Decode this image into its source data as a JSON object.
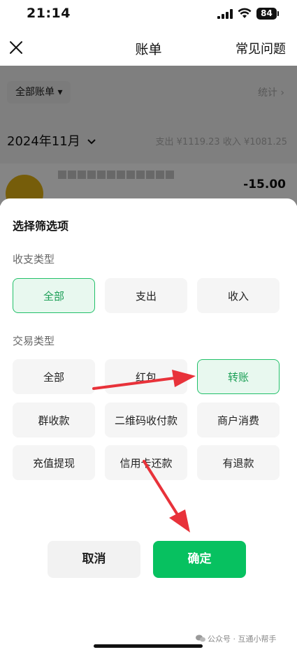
{
  "status_bar": {
    "time": "21:14",
    "battery": "84"
  },
  "nav": {
    "title": "账单",
    "faq": "常见问题"
  },
  "background": {
    "filter_label": "全部账单 ▾",
    "stats_label": "统计 ›",
    "month": "2024年11月",
    "summary": "支出 ¥1119.23   收入 ¥1081.25",
    "bill_amount": "-15.00"
  },
  "sheet": {
    "title": "选择筛选项",
    "income_type_label": "收支类型",
    "income_options": [
      {
        "label": "全部",
        "selected": true
      },
      {
        "label": "支出",
        "selected": false
      },
      {
        "label": "收入",
        "selected": false
      }
    ],
    "trade_type_label": "交易类型",
    "trade_options": [
      {
        "label": "全部",
        "selected": false
      },
      {
        "label": "红包",
        "selected": false
      },
      {
        "label": "转账",
        "selected": true
      },
      {
        "label": "群收款",
        "selected": false
      },
      {
        "label": "二维码收付款",
        "selected": false
      },
      {
        "label": "商户消费",
        "selected": false
      },
      {
        "label": "充值提现",
        "selected": false
      },
      {
        "label": "信用卡还款",
        "selected": false
      },
      {
        "label": "有退款",
        "selected": false
      }
    ],
    "cancel": "取消",
    "confirm": "确定"
  },
  "watermark": "公众号 · 互通小帮手",
  "colors": {
    "accent": "#07c160",
    "selected_bg": "#e8f8ef",
    "annotation_arrow": "#e8323a"
  }
}
